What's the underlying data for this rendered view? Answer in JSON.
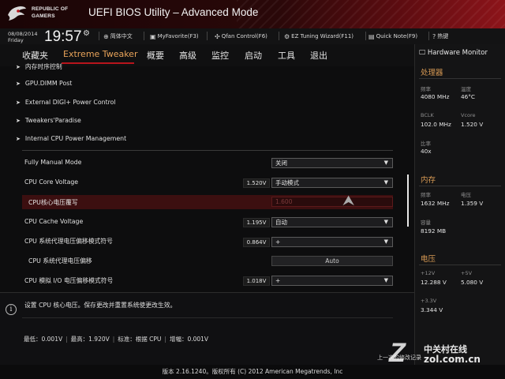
{
  "brand": {
    "line1": "REPUBLIC OF",
    "line2": "GAMERS"
  },
  "window_title": "UEFI BIOS Utility – Advanced Mode",
  "datetime": {
    "date": "08/08/2014",
    "day": "Friday",
    "time": "19:57"
  },
  "toolbar": [
    {
      "icon": "globe-icon",
      "label": "简体中文"
    },
    {
      "icon": "favorite-icon",
      "label": "MyFavorite(F3)"
    },
    {
      "icon": "fan-icon",
      "label": "Qfan Control(F6)"
    },
    {
      "icon": "tuning-icon",
      "label": "EZ Tuning Wizard(F11)"
    },
    {
      "icon": "note-icon",
      "label": "Quick Note(F9)"
    },
    {
      "icon": "hotkey-icon",
      "label": "热键"
    }
  ],
  "nav": {
    "tabs": [
      "收藏夹",
      "Extreme Tweaker",
      "概要",
      "高级",
      "监控",
      "启动",
      "工具",
      "退出"
    ],
    "active": "Extreme Tweaker"
  },
  "menu_links": [
    "内存时序控制",
    "GPU.DIMM Post",
    "External DIGI+ Power Control",
    "Tweakers'Paradise",
    "Internal CPU Power Management"
  ],
  "settings": [
    {
      "label": "Fully Manual Mode",
      "voltage": "",
      "value": "关闭",
      "dropdown": true
    },
    {
      "label": "CPU Core Voltage",
      "voltage": "1.520V",
      "value": "手动模式",
      "dropdown": true
    },
    {
      "label": "CPU核心电压覆写",
      "voltage": "",
      "value": "1.600",
      "dropdown": false
    },
    {
      "label": "CPU Cache Voltage",
      "voltage": "1.195V",
      "value": "自动",
      "dropdown": true
    },
    {
      "label": "CPU 系统代理电压偏移模式符号",
      "voltage": "0.864V",
      "value": "+",
      "dropdown": true
    },
    {
      "label": "CPU 系统代理电压偏移",
      "voltage": "",
      "value": "Auto",
      "dropdown": false
    },
    {
      "label": "CPU 模拟 I/O 电压偏移模式符号",
      "voltage": "1.018V",
      "value": "+",
      "dropdown": true
    }
  ],
  "help": {
    "text": "设置 CPU 核心电压。保存更改并重置系统使更改生效。",
    "range": [
      "最低：0.001V",
      "最高：1.920V",
      "标准：根据 CPU",
      "增幅：0.001V"
    ]
  },
  "hardware_monitor": {
    "title": "Hardware Monitor",
    "cpu": {
      "section": "处理器",
      "freq_label": "频率",
      "freq": "4080 MHz",
      "temp_label": "温度",
      "temp": "46°C",
      "bclk_label": "BCLK",
      "bclk": "102.0 MHz",
      "vcore_label": "Vcore",
      "vcore": "1.520 V",
      "ratio_label": "比率",
      "ratio": "40x"
    },
    "memory": {
      "section": "内存",
      "freq_label": "频率",
      "freq": "1632 MHz",
      "volt_label": "电压",
      "volt": "1.359 V",
      "cap_label": "容量",
      "cap": "8192 MB"
    },
    "voltage": {
      "section": "电压",
      "v12_label": "+12V",
      "v12": "12.288 V",
      "v5_label": "+5V",
      "v5": "5.080 V",
      "v33_label": "+3.3V",
      "v33": "3.344 V"
    }
  },
  "footer": {
    "last_change": "上一次的修改记录",
    "version": "版本 2.16.1240。版权所有 (C) 2012 American Megatrends, Inc"
  },
  "watermark": {
    "cn": "中关村在线",
    "url": "zol.com.cn"
  },
  "colors": {
    "accent_red": "#b8141c",
    "active_tab": "#e8a35a",
    "section_title": "#d89a54",
    "highlight_row": "#3c0f10"
  }
}
